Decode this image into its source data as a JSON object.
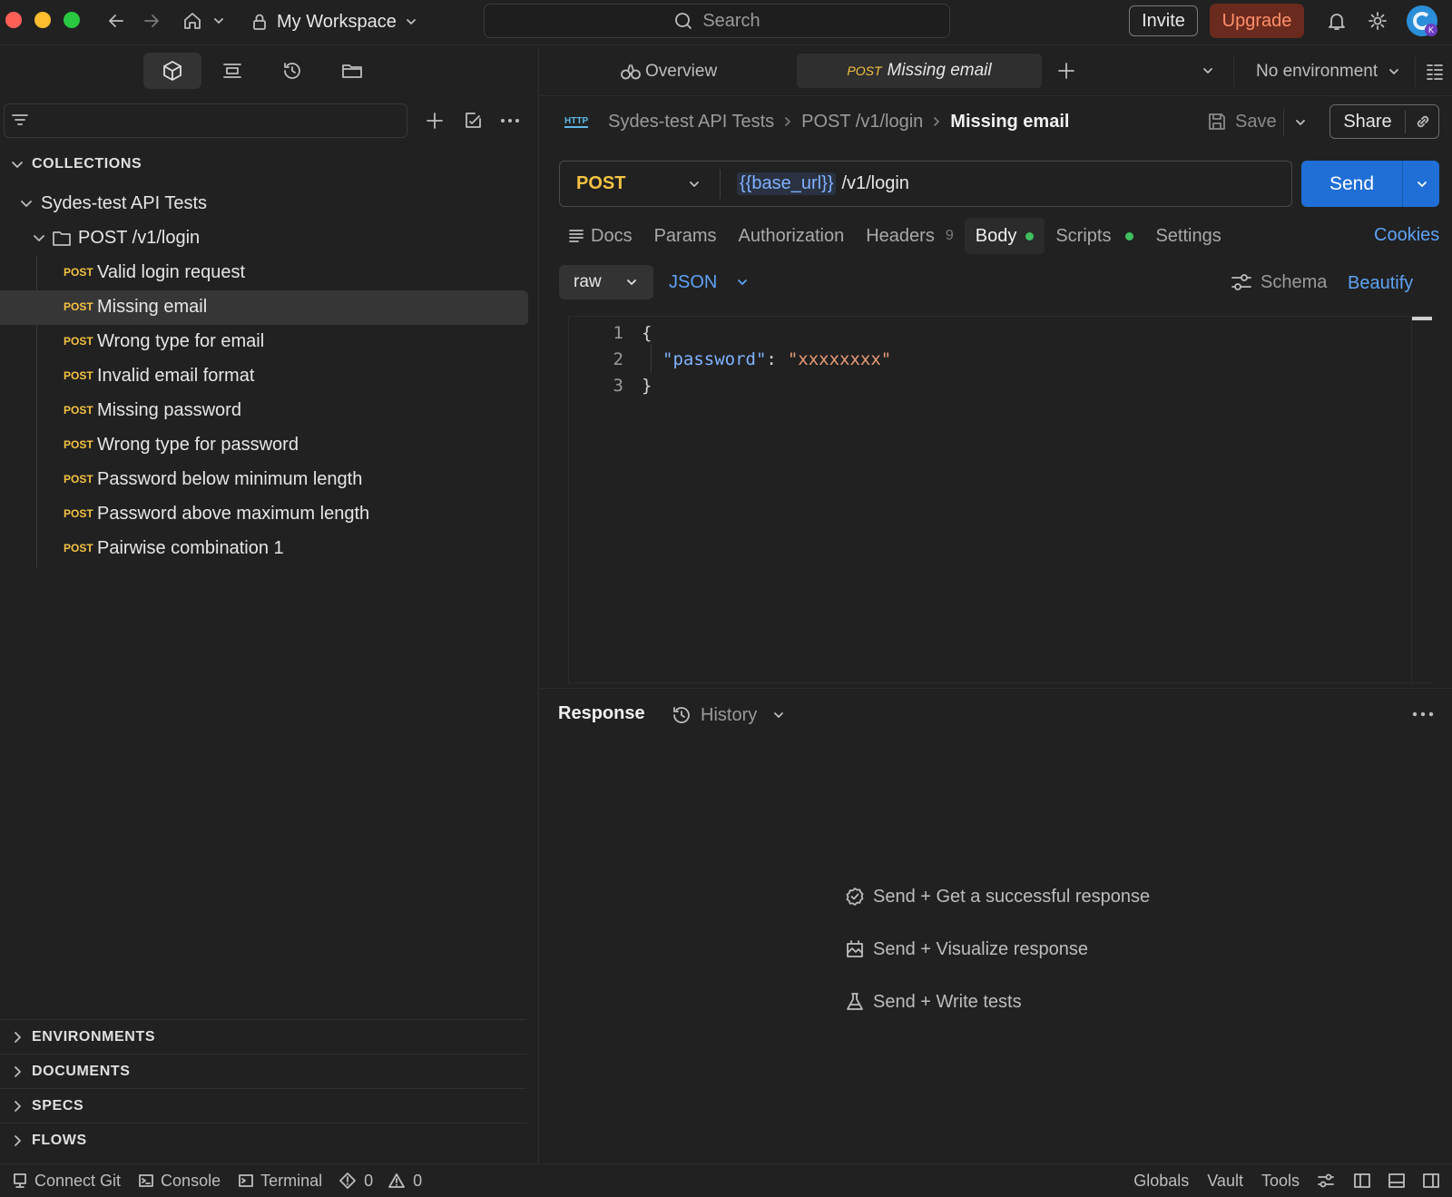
{
  "titlebar": {
    "workspace": "My Workspace",
    "search_placeholder": "Search",
    "invite": "Invite",
    "upgrade": "Upgrade"
  },
  "tabs": {
    "overview": "Overview",
    "active_method": "POST",
    "active_name": "Missing email",
    "environment": "No environment"
  },
  "sidebar": {
    "collections_label": "COLLECTIONS",
    "collection_name": "Sydes-test API Tests",
    "folder_name": "POST /v1/login",
    "method_tag": "POST",
    "requests": [
      "Valid login request",
      "Missing email",
      "Wrong type for email",
      "Invalid email format",
      "Missing password",
      "Wrong type for password",
      "Password below minimum length",
      "Password above maximum length",
      "Pairwise combination 1"
    ],
    "sections": [
      "ENVIRONMENTS",
      "DOCUMENTS",
      "SPECS",
      "FLOWS"
    ]
  },
  "breadcrumb": {
    "collection": "Sydes-test API Tests",
    "folder": "POST /v1/login",
    "current": "Missing email",
    "save": "Save",
    "share": "Share"
  },
  "request": {
    "method": "POST",
    "url_variable": "{{base_url}}",
    "url_path": "/v1/login",
    "send": "Send"
  },
  "req_tabs": {
    "docs": "Docs",
    "params": "Params",
    "authorization": "Authorization",
    "headers": "Headers",
    "headers_count": "9",
    "body": "Body",
    "scripts": "Scripts",
    "settings": "Settings",
    "cookies": "Cookies"
  },
  "body_opts": {
    "mode": "raw",
    "format": "JSON",
    "schema": "Schema",
    "beautify": "Beautify"
  },
  "editor": {
    "line_numbers": [
      "1",
      "2",
      "3"
    ],
    "open_brace": "{",
    "key": "\"password\"",
    "colon": ":",
    "value": "\"xxxxxxxx\"",
    "close_brace": "}"
  },
  "response": {
    "title": "Response",
    "history": "History",
    "hints": [
      "Send + Get a successful response",
      "Send + Visualize response",
      "Send + Write tests"
    ]
  },
  "statusbar": {
    "connect_git": "Connect Git",
    "console": "Console",
    "terminal": "Terminal",
    "errors": "0",
    "warnings": "0",
    "globals": "Globals",
    "vault": "Vault",
    "tools": "Tools"
  },
  "colors": {
    "accent_blue": "#1f6fd6",
    "post_yellow": "#f5c242",
    "upgrade_text": "#ff8f6a",
    "json_key": "#7fb2ff",
    "json_string": "#e79a76",
    "status_dot": "#3fbf5f"
  }
}
